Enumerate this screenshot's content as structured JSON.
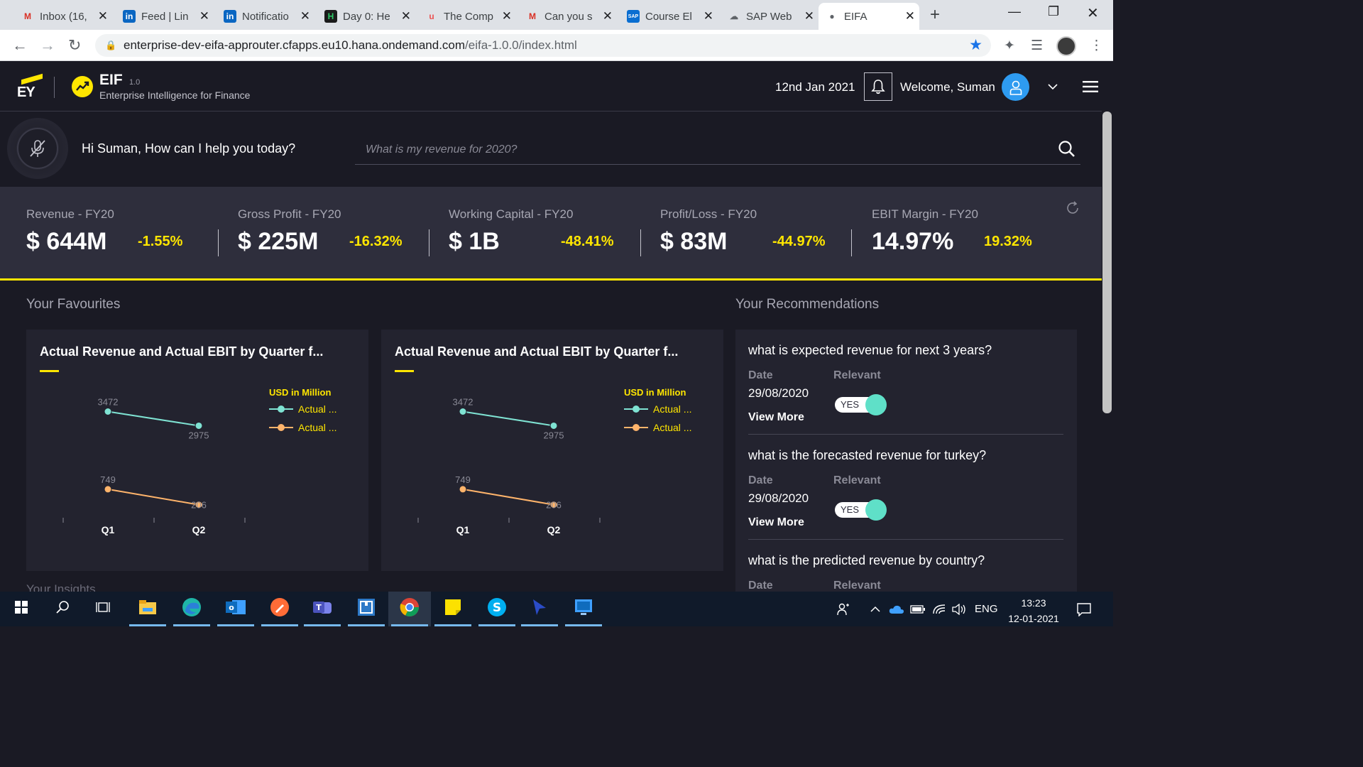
{
  "browser": {
    "tabs": [
      {
        "label": "Inbox (16,",
        "icon": "gmail-icon",
        "color": "#d93025"
      },
      {
        "label": "Feed | Lin",
        "icon": "linkedin-icon",
        "color": "#0a66c2"
      },
      {
        "label": "Notificatio",
        "icon": "linkedin-icon",
        "color": "#0a66c2"
      },
      {
        "label": "Day 0: He",
        "icon": "hackerrank-icon",
        "color": "#1b1b1b"
      },
      {
        "label": "The Comp",
        "icon": "udemy-icon",
        "color": "#ec5252"
      },
      {
        "label": "Can you s",
        "icon": "gmail-icon",
        "color": "#d93025"
      },
      {
        "label": "Course El",
        "icon": "sap-icon",
        "color": "#0a6ed1"
      },
      {
        "label": "SAP Web",
        "icon": "cloud-icon",
        "color": "#5f6368"
      },
      {
        "label": "EIFA",
        "icon": "globe-icon",
        "color": "#5f6368"
      }
    ],
    "url_host": "enterprise-dev-eifa-approuter.cfapps.eu10.hana.ondemand.com",
    "url_path": "/eifa-1.0.0/index.html"
  },
  "header": {
    "brand": "EY",
    "app_name": "EIF",
    "app_version": "1.0",
    "app_subtitle": "Enterprise Intelligence for Finance",
    "date": "12nd Jan 2021",
    "welcome": "Welcome, Suman"
  },
  "ask": {
    "greeting": "Hi Suman, How can I help you today?",
    "placeholder": "What is my revenue for 2020?"
  },
  "kpis": [
    {
      "label": "Revenue - FY20",
      "value": "$ 644M",
      "change": "-1.55%"
    },
    {
      "label": "Gross Profit - FY20",
      "value": "$ 225M",
      "change": "-16.32%"
    },
    {
      "label": "Working Capital - FY20",
      "value": "$ 1B",
      "change": "-48.41%"
    },
    {
      "label": "Profit/Loss - FY20",
      "value": "$ 83M",
      "change": "-44.97%"
    },
    {
      "label": "EBIT Margin - FY20",
      "value": "14.97%",
      "change": "19.32%"
    }
  ],
  "favourites": {
    "title": "Your Favourites",
    "cards": [
      {
        "title": "Actual Revenue and Actual EBIT by Quarter f..."
      },
      {
        "title": "Actual Revenue and Actual EBIT by Quarter f..."
      }
    ]
  },
  "chart_data": [
    {
      "type": "line",
      "categories": [
        "Q1",
        "Q2"
      ],
      "series": [
        {
          "name": "Actual ...",
          "values": [
            3472,
            2975
          ],
          "color": "#7fe3d3"
        },
        {
          "name": "Actual ...",
          "values": [
            749,
            206
          ],
          "color": "#ffb46b"
        }
      ],
      "legend_title": "USD in Million",
      "data_labels": [
        "3472",
        "2975",
        "749",
        "206"
      ]
    },
    {
      "type": "line",
      "categories": [
        "Q1",
        "Q2"
      ],
      "series": [
        {
          "name": "Actual ...",
          "values": [
            3472,
            2975
          ],
          "color": "#7fe3d3"
        },
        {
          "name": "Actual ...",
          "values": [
            749,
            206
          ],
          "color": "#ffb46b"
        }
      ],
      "legend_title": "USD in Million",
      "data_labels": [
        "3472",
        "2975",
        "749",
        "206"
      ]
    }
  ],
  "recommendations": {
    "title": "Your Recommendations",
    "date_label": "Date",
    "relevant_label": "Relevant",
    "view_more": "View More",
    "toggle_label": "YES",
    "items": [
      {
        "question": "what is expected revenue for next 3 years?",
        "date": "29/08/2020"
      },
      {
        "question": "what is the forecasted revenue for turkey?",
        "date": "29/08/2020"
      },
      {
        "question": "what is the predicted revenue by country?",
        "date": ""
      }
    ]
  },
  "peek_text": "Your Insights",
  "taskbar": {
    "apps": [
      "start-icon",
      "search-icon",
      "task-view-icon",
      "file-explorer-icon",
      "edge-icon",
      "outlook-icon",
      "postman-icon",
      "teams-icon",
      "code-icon",
      "chrome-icon",
      "sticky-notes-icon",
      "skype-icon",
      "pointer-icon",
      "remote-desktop-icon"
    ],
    "language": "ENG",
    "time": "13:23",
    "date": "12-01-2021"
  },
  "colors": {
    "accent": "#ffe600",
    "background": "#1a1a24",
    "kpi_band": "#2e2e3c",
    "card": "#23232f",
    "teal": "#7fe3d3",
    "orange": "#ffb46b"
  }
}
